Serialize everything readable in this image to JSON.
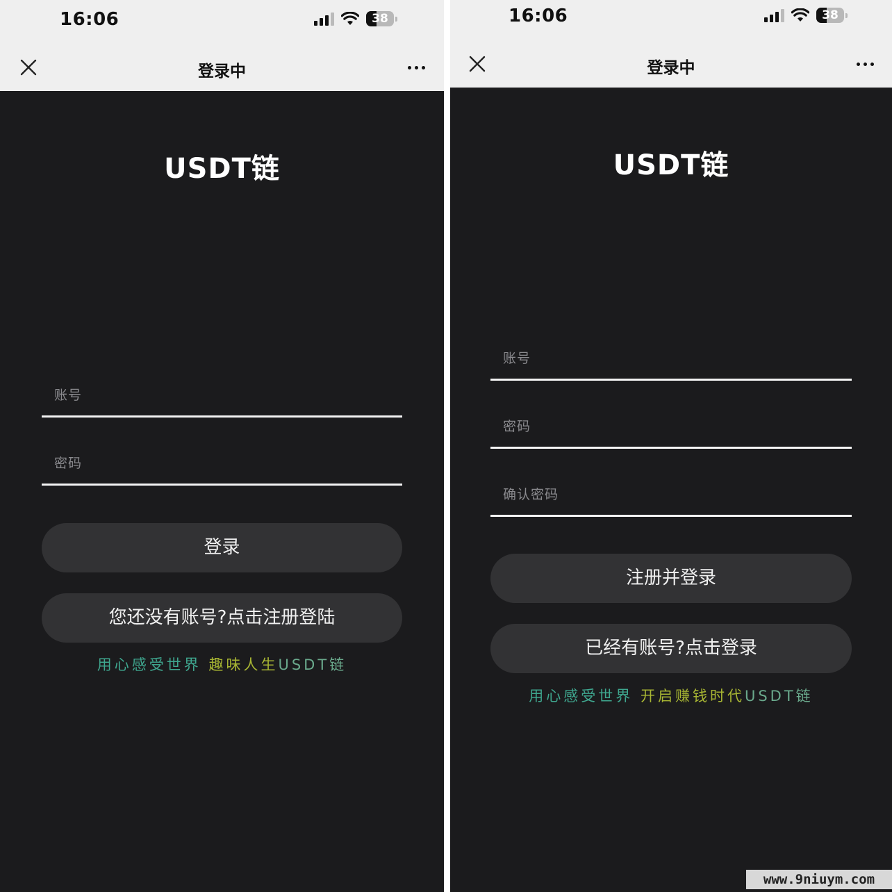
{
  "status_bar": {
    "time": "16:06",
    "battery": "38",
    "icons": [
      "signal-icon",
      "wifi-icon",
      "battery-icon"
    ]
  },
  "navbar": {
    "title": "登录中",
    "icons": [
      "close-icon",
      "more-icon"
    ]
  },
  "login_screen": {
    "app_title": "USDT链",
    "account_placeholder": "账号",
    "password_placeholder": "密码",
    "login_button": "登录",
    "register_link_button": "您还没有账号?点击注册登陆",
    "slogan_part1": "用心感受世界",
    "slogan_part2": "趣味人生",
    "slogan_part3": "USDT链"
  },
  "register_screen": {
    "app_title": "USDT链",
    "account_placeholder": "账号",
    "password_placeholder": "密码",
    "confirm_password_placeholder": "确认密码",
    "register_button": "注册并登录",
    "login_link_button": "已经有账号?点击登录",
    "slogan_part1": "用心感受世界",
    "slogan_part2": "开启赚钱时代",
    "slogan_part3": "USDT链"
  },
  "watermark": "www.9niuym.com",
  "colors": {
    "background": "#1b1b1d",
    "button": "#323234",
    "topbar": "#efefef",
    "slogan_green": "#3fa78f",
    "slogan_yellow": "#a8b633"
  }
}
